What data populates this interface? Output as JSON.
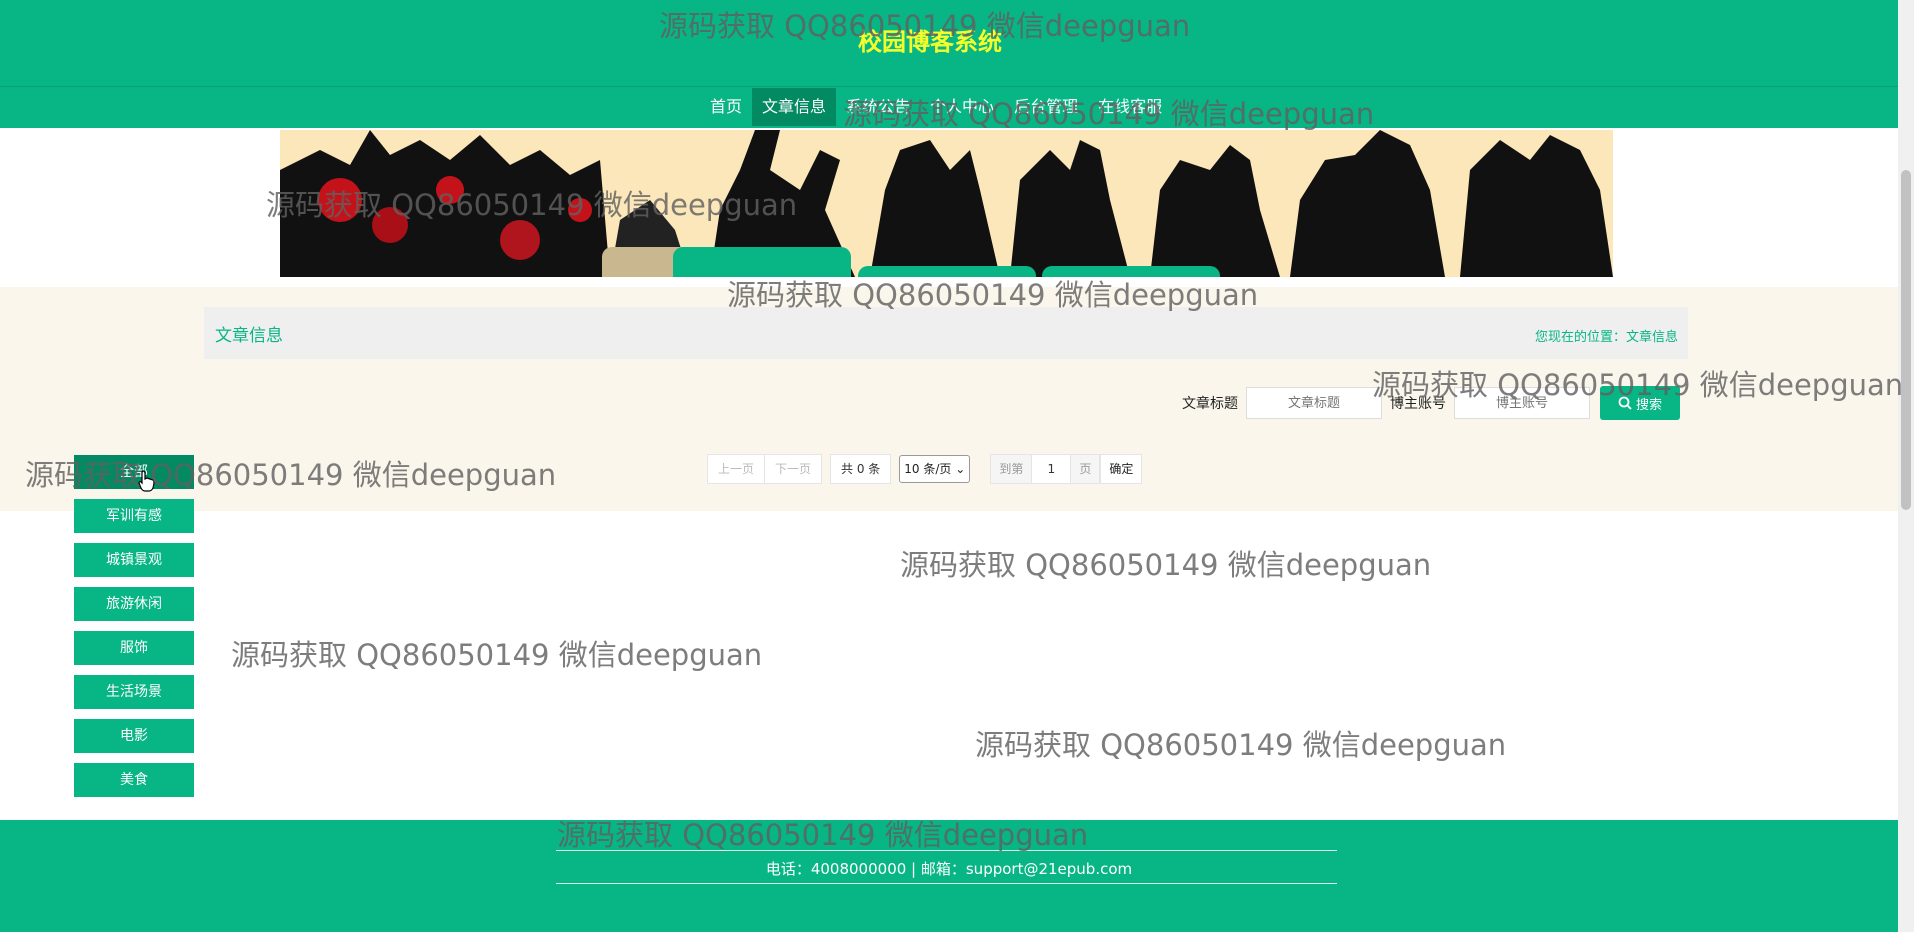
{
  "header": {
    "site_title": "校园博客系统",
    "nav": [
      "首页",
      "文章信息",
      "系统公告",
      "个人中心",
      "后台管理",
      "在线客服"
    ],
    "active_nav": "文章信息"
  },
  "breadcrumb": {
    "title": "文章信息",
    "location": "您现在的位置：文章信息"
  },
  "search": {
    "title_label": "文章标题",
    "title_placeholder": "文章标题",
    "title_value": "",
    "account_label": "博主账号",
    "account_placeholder": "博主账号",
    "account_value": "",
    "button_label": "搜索"
  },
  "pagination": {
    "prev": "上一页",
    "next": "下一页",
    "total": "共 0 条",
    "page_size": "10 条/页",
    "goto_label": "到第",
    "page_number": "1",
    "page_unit": "页",
    "confirm": "确定"
  },
  "categories": [
    "全部",
    "军训有感",
    "城镇景观",
    "旅游休闲",
    "服饰",
    "生活场景",
    "电影",
    "美食"
  ],
  "active_category": "全部",
  "footer": {
    "contact": "电话：4008000000 | 邮箱：support@21epub.com"
  },
  "watermark": "源码获取 QQ86050149 微信deepguan",
  "colors": {
    "primary": "#07b585",
    "primary_dark": "#028a63",
    "title_yellow": "#f5ff2a",
    "content_bg": "#fbf6ec"
  },
  "icons": {
    "search_button": "search-icon",
    "select": "chevron-down-icon",
    "cursor": "hand-pointer-icon"
  }
}
